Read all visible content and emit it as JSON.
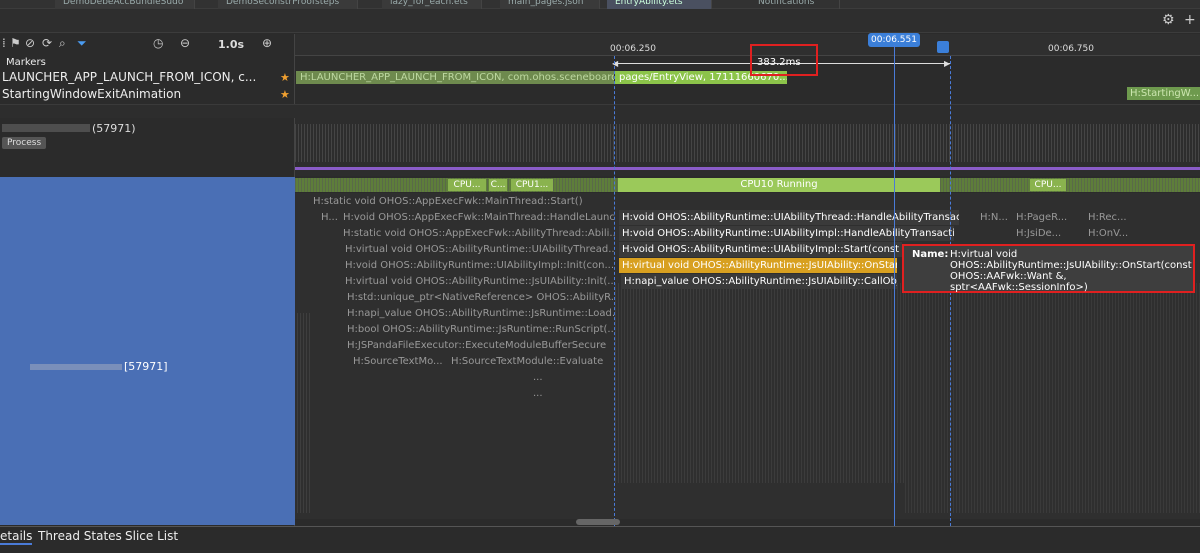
{
  "tabs": [
    "DemoDebeAccBundleSudo",
    "DemoSeconstrProofsteps",
    "lazy_for_each.ets",
    "main_pages.json",
    "EntryAbility.ets",
    "Notifications"
  ],
  "toolbar": {
    "zoom": "1.0s"
  },
  "ruler": {
    "t1": "00:06.250",
    "t2": "00:06.750",
    "cursor": "00:06.551",
    "measure": "383.2ms"
  },
  "tracks": {
    "markers": "Markers",
    "launch": "LAUNCHER_APP_LAUNCH_FROM_ICON, c...",
    "anim": "StartingWindowExitAnimation",
    "process_name": "(57971)",
    "process_badge": "Process",
    "thread_name": "[57971]"
  },
  "bars": {
    "launch": "H:LAUNCHER_APP_LAUNCH_FROM_ICON, com.ohos.sceneboard",
    "launch2": "pages/EntryView, 17111660670...",
    "anim": "H:StartingW..."
  },
  "cpu": {
    "running": "CPU10 Running",
    "seg1": "CPU...",
    "seg2": "C...",
    "seg3": "CPU1...",
    "seg4": "CPU..."
  },
  "slices": {
    "s0": "H:static void OHOS::AppExecFwk::MainThread::Start()",
    "s1a": "H...",
    "s1b": "H:void OHOS::AppExecFwk::MainThread::HandleLaunc...",
    "s1c": "H:void OHOS::AbilityRuntime::UIAbilityThread::HandleAbilityTransac...",
    "s1d": "H:N...",
    "s1e": "H:PageR...",
    "s1f": "H:Rec...",
    "s2a": "H:static void OHOS::AppExecFwk::AbilityThread::Abili...",
    "s2b": "H:void OHOS::AbilityRuntime::UIAbilityImpl::HandleAbilityTransactio...",
    "s2c": "H:JsiDe...",
    "s2d": "H:OnV...",
    "s3a": "H:virtual void OHOS::AbilityRuntime::UIAbilityThread...",
    "s3b": "H:void OHOS::AbilityRuntime::UIAbilityImpl::Start(const A",
    "s4a": "H:void OHOS::AbilityRuntime::UIAbilityImpl::Init(con...",
    "s4b": "H:virtual void OHOS::AbilityRuntime::JsUIAbility::OnStart",
    "s5a": "H:virtual void OHOS::AbilityRuntime::JsUIAbility::Init(...",
    "s5b": "H:napi_value OHOS::AbilityRuntime::JsUIAbility::CallObj",
    "s6": "H:std::unique_ptr<NativeReference> OHOS::AbilityR...",
    "s7": "H:napi_value OHOS::AbilityRuntime::JsRuntime::Load...",
    "s8": "H:bool OHOS::AbilityRuntime::JsRuntime::RunScript(...",
    "s9": "H:JSPandaFileExecutor::ExecuteModuleBufferSecure",
    "s10a": "H:SourceTextMo...",
    "s10b": "H:SourceTextModule::Evaluate",
    "s11": "...",
    "s12": "..."
  },
  "tooltip": {
    "key": "Name:",
    "value": "H:virtual void OHOS::AbilityRuntime::JsUIAbility::OnStart(const OHOS::AAFwk::Want &, sptr<AAFwk::SessionInfo>)"
  },
  "bottom_tabs": {
    "details": "etails",
    "thread_states": "Thread States",
    "slice_list": "Slice List"
  }
}
